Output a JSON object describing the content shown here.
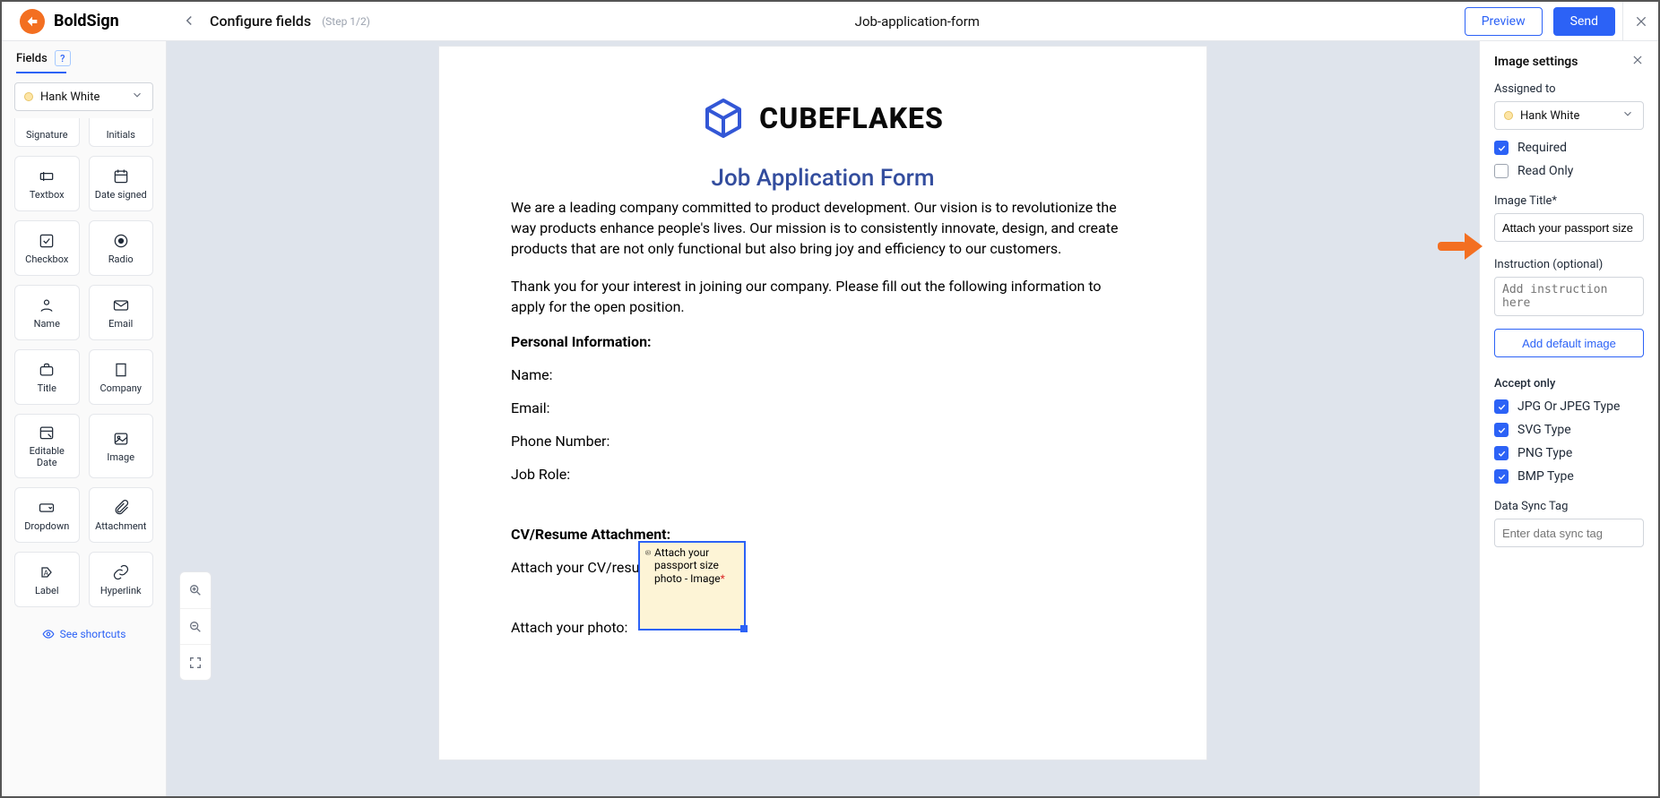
{
  "brand": "BoldSign",
  "header": {
    "back_tooltip": "Back",
    "config_title": "Configure fields",
    "step_label": "(Step 1/2)",
    "doc_name": "Job-application-form",
    "preview_btn": "Preview",
    "send_btn": "Send"
  },
  "left": {
    "tab": "Fields",
    "signer": "Hank White",
    "tiles": [
      {
        "name": "Signature"
      },
      {
        "name": "Initials"
      },
      {
        "name": "Textbox",
        "icon": "textbox"
      },
      {
        "name": "Date signed",
        "icon": "calendar"
      },
      {
        "name": "Checkbox",
        "icon": "checkbox"
      },
      {
        "name": "Radio",
        "icon": "radio"
      },
      {
        "name": "Name",
        "icon": "person"
      },
      {
        "name": "Email",
        "icon": "mail"
      },
      {
        "name": "Title",
        "icon": "briefcase"
      },
      {
        "name": "Company",
        "icon": "building"
      },
      {
        "name": "Editable Date",
        "icon": "date-edit"
      },
      {
        "name": "Image",
        "icon": "image"
      },
      {
        "name": "Dropdown",
        "icon": "dropdown"
      },
      {
        "name": "Attachment",
        "icon": "clip"
      },
      {
        "name": "Label",
        "icon": "label"
      },
      {
        "name": "Hyperlink",
        "icon": "link"
      }
    ],
    "shortcuts": "See shortcuts"
  },
  "doc": {
    "brand": "CUBEFLAKES",
    "title": "Job Application Form",
    "p1": "We are a leading company committed to product development. Our vision is to revolutionize the way products enhance people's lives. Our mission is to consistently innovate, design, and create products that are not only functional but also bring joy and efficiency to our customers.",
    "p2": "Thank you for your interest in joining our company. Please fill out the following information to apply for the open position.",
    "sec_personal": "Personal Information:",
    "f_name": "Name:",
    "f_email": "Email:",
    "f_phone": "Phone Number:",
    "f_role": "Job Role:",
    "sec_cv": "CV/Resume Attachment:",
    "f_cv": "Attach your CV/resumé:",
    "f_photo": "Attach your photo:",
    "placeholder_text": "Attach your passport size photo - Image",
    "placeholder_req": "*"
  },
  "right": {
    "title": "Image settings",
    "assigned_label": "Assigned to",
    "signer": "Hank White",
    "required_label": "Required",
    "required_checked": true,
    "readonly_label": "Read Only",
    "readonly_checked": false,
    "image_title_label": "Image Title*",
    "image_title_value": "Attach your passport size photo",
    "instruction_label": "Instruction (optional)",
    "instruction_placeholder": "Add instruction here",
    "add_default_btn": "Add default image",
    "accept_label": "Accept only",
    "accept": [
      {
        "label": "JPG Or JPEG Type",
        "checked": true
      },
      {
        "label": "SVG Type",
        "checked": true
      },
      {
        "label": "PNG Type",
        "checked": true
      },
      {
        "label": "BMP Type",
        "checked": true
      }
    ],
    "sync_label": "Data Sync Tag",
    "sync_placeholder": "Enter data sync tag"
  }
}
